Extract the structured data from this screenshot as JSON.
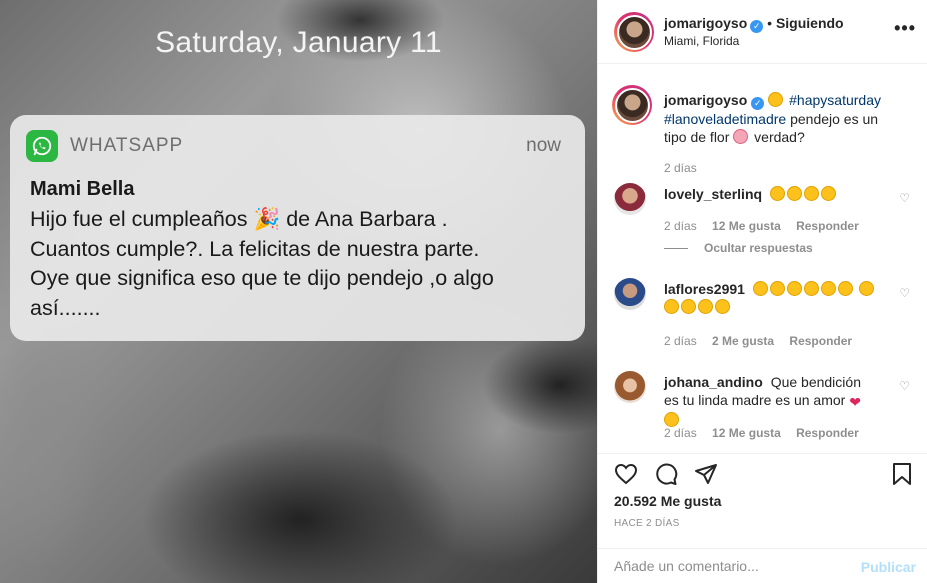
{
  "photo": {
    "lock_date": "Saturday, January 11",
    "notification": {
      "app_name": "WHATSAPP",
      "time": "now",
      "sender": "Mami Bella",
      "body_lines": [
        "Hijo fue el cumpleaños 🎉 de Ana Barbara .",
        "Cuantos cumple?. La felicitas de nuestra parte.",
        "Oye que significa eso que te dijo pendejo ,o algo",
        "así......."
      ]
    }
  },
  "header": {
    "username": "jomarigoyso",
    "separator": "•",
    "follow_status": "Siguiendo",
    "location": "Miami, Florida",
    "more_icon": "more-horizontal-icon"
  },
  "caption": {
    "username": "jomarigoyso",
    "hashtag1": "#hapysaturday",
    "hashtag2": "#lanoveladetimadre",
    "text": "pendejo es un tipo de flor",
    "text_end": "verdad?",
    "time": "2 días"
  },
  "comments": [
    {
      "username": "lovely_sterlinq",
      "text": "",
      "time": "2 días",
      "likes": "12 Me gusta",
      "reply": "Responder",
      "hide_replies": "Ocultar respuestas"
    },
    {
      "username": "laflores2991",
      "text": "",
      "time": "2 días",
      "likes": "2 Me gusta",
      "reply": "Responder"
    },
    {
      "username": "johana_andino",
      "text": "Que bendición es tu linda madre es un amor",
      "time": "2 días",
      "likes": "12 Me gusta",
      "reply": "Responder"
    }
  ],
  "actions": {
    "likes": "20.592 Me gusta",
    "posted": "HACE 2 DÍAS",
    "comment_placeholder": "Añade un comentario...",
    "publish": "Publicar"
  },
  "colors": {
    "whatsapp_green": "#2bb741",
    "verified_blue": "#3897f0",
    "hashtag_blue": "#00376b",
    "publish_disabled": "#b2dffc"
  }
}
